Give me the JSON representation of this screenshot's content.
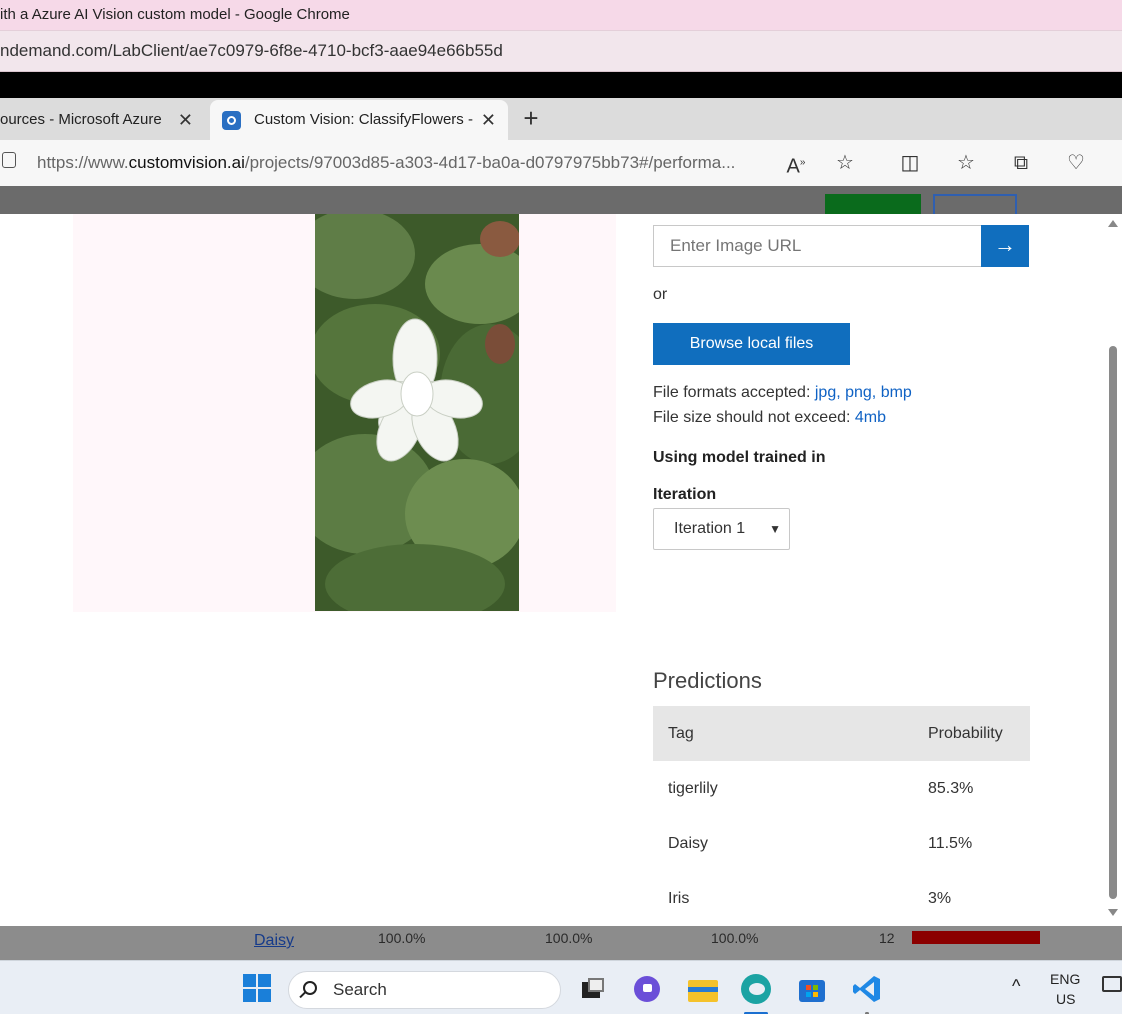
{
  "outer_window": {
    "title": "ith a Azure AI Vision custom model - Google Chrome",
    "url": "ndemand.com/LabClient/ae7c0979-6f8e-4710-bcf3-aae94e66b55d"
  },
  "browser": {
    "tabs": [
      {
        "label": "ources - Microsoft Azure",
        "active": false
      },
      {
        "label": "Custom Vision: ClassifyFlowers - ",
        "active": true
      }
    ],
    "address": {
      "prefix": "https://www.",
      "domain": "customvision.ai",
      "path": "/projects/97003d85-a303-4d17-ba0a-d0797975bb73#/performa..."
    },
    "icons": [
      "read-aloud-icon",
      "favorite-star-icon",
      "split-screen-icon",
      "favorites-icon",
      "collections-icon",
      "browser-essentials-icon"
    ]
  },
  "quick_test": {
    "url_placeholder": "Enter Image URL",
    "or_label": "or",
    "browse_label": "Browse local files",
    "formats_label": "File formats accepted:",
    "formats_value": "jpg, png, bmp",
    "size_label": "File size should not exceed:",
    "size_value": "4mb",
    "model_heading": "Using model trained in",
    "iteration_label": "Iteration",
    "iteration_value": "Iteration 1"
  },
  "predictions": {
    "title": "Predictions",
    "columns": [
      "Tag",
      "Probability"
    ],
    "rows": [
      {
        "tag": "tigerlily",
        "probability": "85.3%"
      },
      {
        "tag": "Daisy",
        "probability": "11.5%"
      },
      {
        "tag": "Iris",
        "probability": "3%"
      }
    ]
  },
  "background_row": {
    "tag": "Daisy",
    "values": [
      "100.0%",
      "100.0%",
      "100.0%",
      "12"
    ]
  },
  "taskbar": {
    "search_label": "Search",
    "lang_line1": "ENG",
    "lang_line2": "US"
  },
  "colors": {
    "accent": "#106ebe",
    "link": "#0f62c4",
    "table_header": "#e6e6e6"
  }
}
